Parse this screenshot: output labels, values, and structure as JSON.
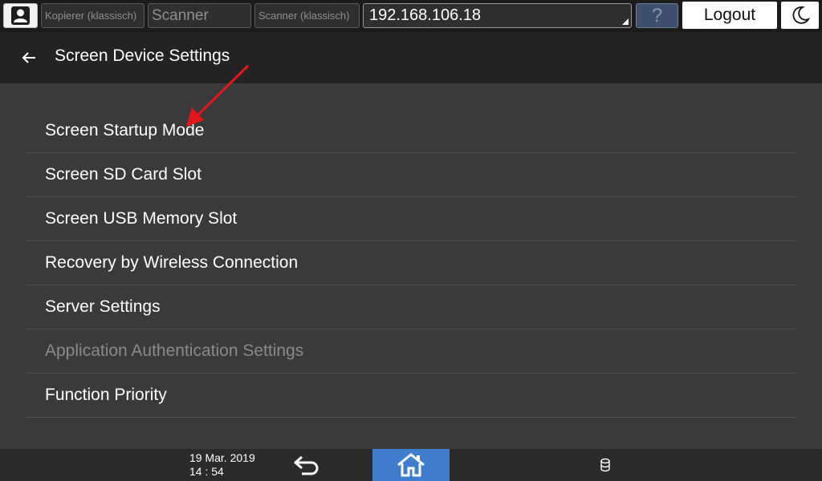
{
  "topbar": {
    "user_icon": "user-icon",
    "tabs": [
      {
        "label": "Kopierer (klassisch)"
      },
      {
        "label": "Scanner"
      },
      {
        "label": "Scanner (klassisch)"
      }
    ],
    "address": "192.168.106.18",
    "help_label": "?",
    "logout_label": "Logout",
    "moon_icon": "moon-icon"
  },
  "header": {
    "back_icon": "back-arrow-icon",
    "title": "Screen Device Settings"
  },
  "menu": {
    "items": [
      {
        "label": "Screen Startup Mode",
        "enabled": true
      },
      {
        "label": "Screen SD Card Slot",
        "enabled": true
      },
      {
        "label": "Screen USB Memory Slot",
        "enabled": true
      },
      {
        "label": "Recovery by Wireless Connection",
        "enabled": true
      },
      {
        "label": "Server Settings",
        "enabled": true
      },
      {
        "label": "Application Authentication Settings",
        "enabled": false
      },
      {
        "label": "Function Priority",
        "enabled": true
      }
    ]
  },
  "bottombar": {
    "date": "19 Mar. 2019",
    "time": "14 : 54",
    "back_icon": "return-icon",
    "home_icon": "home-icon",
    "storage_icon": "storage-icon"
  },
  "colors": {
    "background": "#3a3a3a",
    "header": "#232323",
    "topbar": "#1b1b1b",
    "home_accent": "#3f7ccd",
    "disabled_text": "#8a8a8a",
    "annotation_arrow": "#e3161b"
  }
}
